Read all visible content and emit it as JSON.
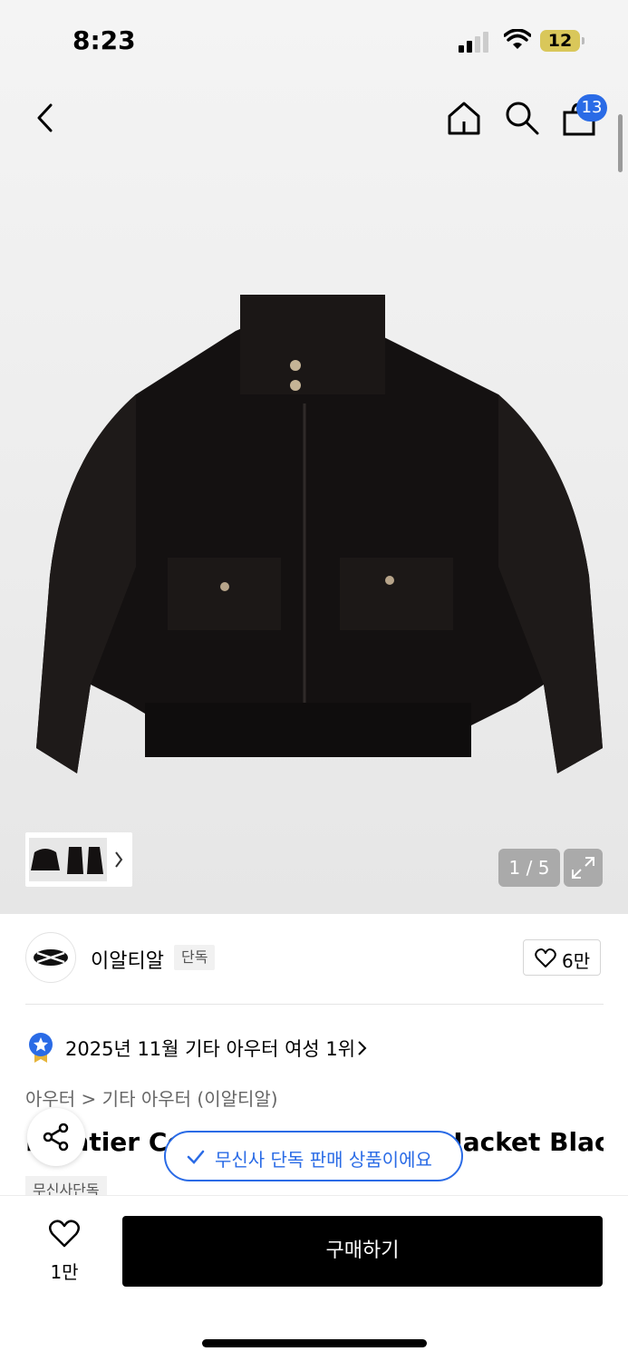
{
  "status_bar": {
    "time": "8:23",
    "battery": "12"
  },
  "header": {
    "cart_count": "13"
  },
  "gallery": {
    "page_counter": "1 / 5"
  },
  "brand": {
    "name": "이알티알",
    "exclusive_badge": "단독",
    "like_count": "6만"
  },
  "ranking": {
    "text": "2025년 11월 기타 아우터 여성 1위"
  },
  "breadcrumb": {
    "text": "아우터 > 기타 아우터 (이알티알)"
  },
  "product": {
    "title": "Frontier Corduroy Harrington Jacket Black",
    "tag": "무신사단독"
  },
  "toast": {
    "text": "무신사 단독 판매 상품이에요"
  },
  "bottom_bar": {
    "wish_count": "1만",
    "buy_label": "구매하기"
  },
  "colors": {
    "accent": "#2a6be6",
    "battery": "#d9c75a"
  }
}
